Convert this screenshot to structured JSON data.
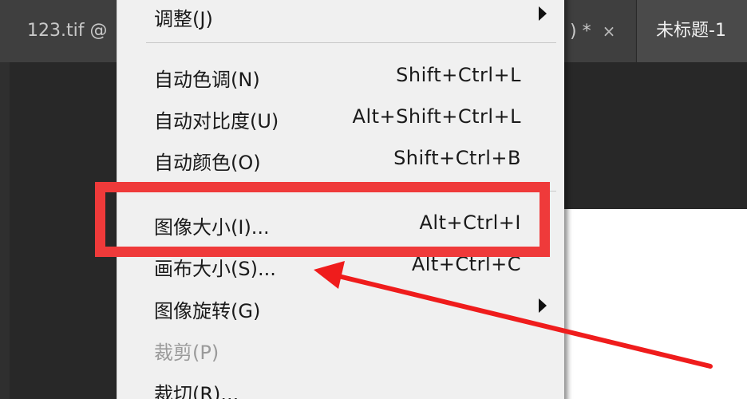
{
  "tabs": [
    {
      "label": "123.tif @"
    },
    {
      "label": ") *",
      "close": "×"
    },
    {
      "label": "未标题-1"
    }
  ],
  "menu": {
    "items": [
      {
        "label": "调整(J)",
        "shortcut": "",
        "submenu": true,
        "enabled": true
      },
      {
        "label": "自动色调(N)",
        "shortcut": "Shift+Ctrl+L",
        "submenu": false,
        "enabled": true
      },
      {
        "label": "自动对比度(U)",
        "shortcut": "Alt+Shift+Ctrl+L",
        "submenu": false,
        "enabled": true
      },
      {
        "label": "自动颜色(O)",
        "shortcut": "Shift+Ctrl+B",
        "submenu": false,
        "enabled": true
      },
      {
        "label": "图像大小(I)...",
        "shortcut": "Alt+Ctrl+I",
        "submenu": false,
        "enabled": true
      },
      {
        "label": "画布大小(S)...",
        "shortcut": "Alt+Ctrl+C",
        "submenu": false,
        "enabled": true
      },
      {
        "label": "图像旋转(G)",
        "shortcut": "",
        "submenu": true,
        "enabled": true
      },
      {
        "label": "裁剪(P)",
        "shortcut": "",
        "submenu": false,
        "enabled": false
      },
      {
        "label": "裁切(R)...",
        "shortcut": "",
        "submenu": false,
        "enabled": true
      }
    ]
  },
  "colors": {
    "highlight": "#ef3a3a",
    "menu_bg": "#f0f0f0",
    "tab_bg": "#3c3c3c",
    "workspace_bg": "#282828"
  }
}
